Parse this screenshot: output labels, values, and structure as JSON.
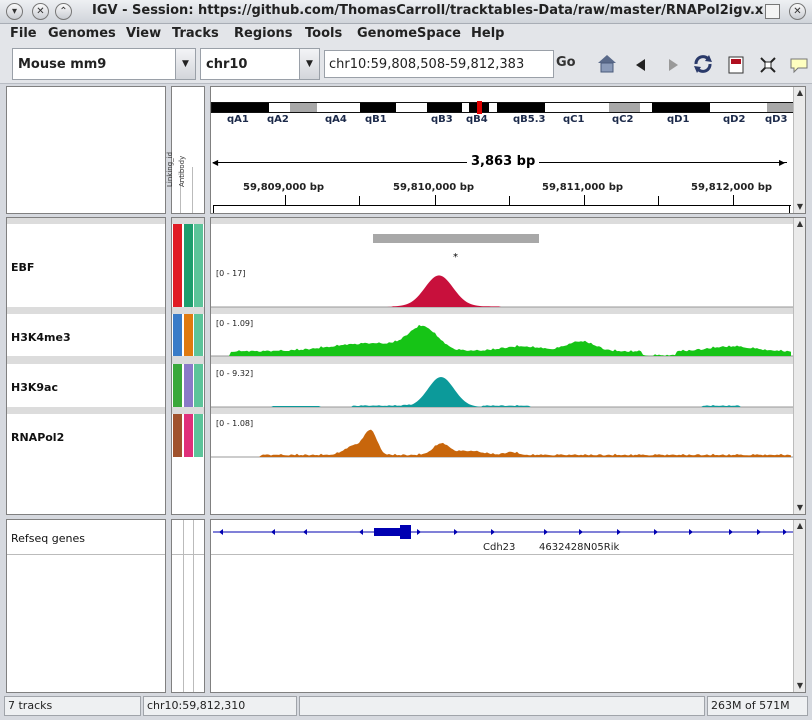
{
  "window": {
    "title": "IGV - Session: https://github.com/ThomasCarroll/tracktables-Data/raw/master/RNAPol2igv.x"
  },
  "menu": {
    "items": [
      "File",
      "Genomes",
      "View",
      "Tracks",
      "Regions",
      "Tools",
      "GenomeSpace",
      "Help"
    ]
  },
  "toolbar": {
    "genome": "Mouse mm9",
    "chromosome": "chr10",
    "locus": "chr10:59,808,508-59,812,383",
    "go_label": "Go"
  },
  "ideogram": {
    "bands": [
      "qA1",
      "qA2",
      "qA4",
      "qB1",
      "qB3",
      "qB4",
      "qB5.3",
      "qC1",
      "qC2",
      "qD1",
      "qD2",
      "qD3"
    ]
  },
  "ruler": {
    "span": "3,863 bp",
    "ticks": [
      "59,809,000 bp",
      "59,810,000 bp",
      "59,811,000 bp",
      "59,812,000 bp"
    ]
  },
  "attributes": {
    "headers": [
      "Linking_id",
      "Antibody"
    ]
  },
  "tracks": [
    {
      "name": "EBF",
      "scale": "[0 - 17]",
      "color": "#c8103c"
    },
    {
      "name": "H3K4me3",
      "scale": "[0 - 1.09]",
      "color": "#16c416"
    },
    {
      "name": "H3K9ac",
      "scale": "[0 - 9.32]",
      "color": "#0c9a9a"
    },
    {
      "name": "RNAPol2",
      "scale": "[0 - 1.08]",
      "color": "#c8660c"
    }
  ],
  "peak_marker": "*",
  "genes": {
    "track_name": "Refseq genes",
    "labels": [
      "Cdh23",
      "4632428N05Rik"
    ],
    "color": "#0000b2"
  },
  "status": {
    "tracks": "7 tracks",
    "position": "chr10:59,812,310",
    "memory": "263M of 571M"
  },
  "colors": {
    "attr_col1": [
      "#e01b24",
      "#3a7cc8",
      "#3aa83a",
      "#a0522d"
    ],
    "attr_col2": [
      "#1e9e6e",
      "#e07a10",
      "#8a7ac8",
      "#e0307a"
    ],
    "attr_col3": "#5cc49a"
  }
}
